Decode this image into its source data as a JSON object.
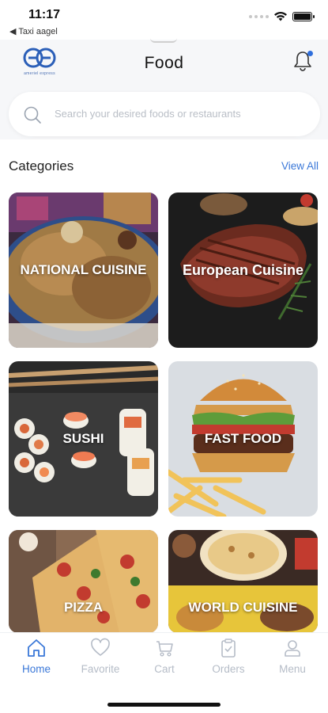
{
  "status_bar": {
    "time": "11:17",
    "back_app": "◀ Taxi aagel"
  },
  "header": {
    "title": "Food",
    "logo_text": "ameriel express",
    "notification_badge": true
  },
  "search": {
    "placeholder": "Search your desired foods or restaurants"
  },
  "categories": {
    "title": "Categories",
    "view_all": "View All",
    "items": [
      {
        "label": "NATIONAL CUISINE"
      },
      {
        "label": "European Cuisine"
      },
      {
        "label": "SUSHI"
      },
      {
        "label": "FAST FOOD"
      },
      {
        "label": "PIZZA"
      },
      {
        "label": "WORLD CUISINE"
      }
    ]
  },
  "bottom_nav": {
    "items": [
      {
        "label": "Home",
        "icon": "home-icon",
        "active": true
      },
      {
        "label": "Favorite",
        "icon": "heart-icon",
        "active": false
      },
      {
        "label": "Cart",
        "icon": "cart-icon",
        "active": false
      },
      {
        "label": "Orders",
        "icon": "clipboard-icon",
        "active": false
      },
      {
        "label": "Menu",
        "icon": "user-icon",
        "active": false
      }
    ]
  },
  "colors": {
    "accent": "#3b78d8",
    "inactive": "#b5bcc7",
    "header_bg": "#f6f7f9"
  }
}
